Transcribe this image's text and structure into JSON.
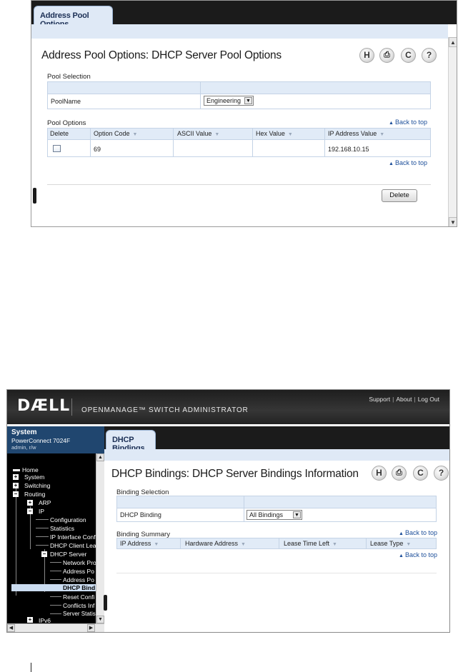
{
  "top": {
    "tab_label": "Address Pool Options",
    "page_title": "Address Pool Options: DHCP Server Pool Options",
    "toolbar": {
      "save_icon": "H",
      "print_icon": "⎙",
      "refresh_icon": "C",
      "help_icon": "?"
    },
    "pool_selection": {
      "section_title": "Pool Selection",
      "field_label": "PoolName",
      "field_value": "Engineering"
    },
    "pool_options": {
      "section_title": "Pool Options",
      "back_to_top": "Back to top",
      "columns": [
        "Delete",
        "Option Code",
        "ASCII Value",
        "Hex Value",
        "IP Address Value"
      ],
      "rows": [
        {
          "option_code": "69",
          "ascii_value": "",
          "hex_value": "",
          "ip_address_value": "192.168.10.15"
        }
      ],
      "back_to_top_2": "Back to top"
    },
    "delete_button": "Delete"
  },
  "bottom": {
    "brand": "DÆLL",
    "product_title": "OPENMANAGE™ SWITCH ADMINISTRATOR",
    "header_links": [
      "Support",
      "About",
      "Log Out"
    ],
    "system": {
      "title": "System",
      "model": "PowerConnect 7024F",
      "user": "admin, r/w"
    },
    "nav": [
      "Home",
      "System",
      "Switching",
      "Routing",
      "ARP",
      "IP",
      "Configuration",
      "Statistics",
      "IP Interface Conf",
      "DHCP Client Lea",
      "DHCP Server",
      "Network Pro",
      "Address Po",
      "Address Po",
      "DHCP Bind",
      "Reset Confi",
      "Conflicts Inf",
      "Server Statis",
      "IPv6"
    ],
    "tab_label": "DHCP Bindings",
    "page_title": "DHCP Bindings: DHCP Server Bindings Information",
    "binding_selection": {
      "section_title": "Binding Selection",
      "field_label": "DHCP Binding",
      "field_value": "All Bindings"
    },
    "binding_summary": {
      "section_title": "Binding Summary",
      "back_to_top": "Back to top",
      "columns": [
        "IP Address",
        "Hardware Address",
        "Lease Time Left",
        "Lease Type"
      ],
      "back_to_top_2": "Back to top"
    }
  },
  "colors": {
    "header_blue": "#dfe9f6",
    "nav_selected": "#cbdcf0",
    "link_blue": "#1d4f9a",
    "banner_dark": "#1b1b1b"
  }
}
